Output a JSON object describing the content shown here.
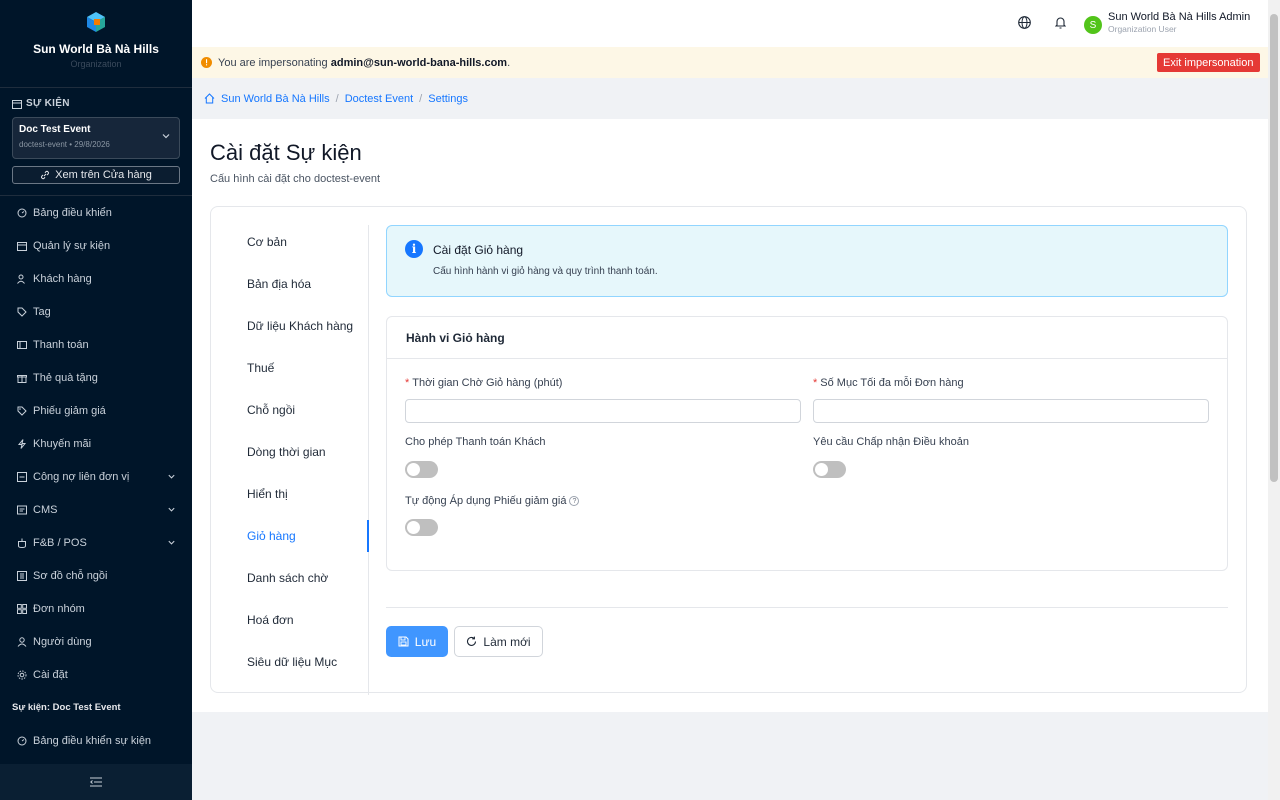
{
  "org": {
    "name": "Sun World Bà Nà Hills",
    "subtitle": "Organization"
  },
  "event_section": {
    "heading": "SỰ KIỆN",
    "event_name": "Doc Test Event",
    "event_meta": "doctest-event • 29/8/2026",
    "view_store": "Xem trên Cửa hàng"
  },
  "nav": {
    "items": [
      {
        "label": "Bảng điều khiển",
        "icon": "dashboard-icon"
      },
      {
        "label": "Quản lý sự kiện",
        "icon": "calendar-icon"
      },
      {
        "label": "Khách hàng",
        "icon": "users-icon"
      },
      {
        "label": "Tag",
        "icon": "tag-icon"
      },
      {
        "label": "Thanh toán",
        "icon": "payment-icon"
      },
      {
        "label": "Thẻ quà tặng",
        "icon": "gift-icon"
      },
      {
        "label": "Phiếu giảm giá",
        "icon": "coupon-icon"
      },
      {
        "label": "Khuyến mãi",
        "icon": "promo-icon"
      },
      {
        "label": "Công nợ liên đơn vị",
        "icon": "debt-icon"
      },
      {
        "label": "CMS",
        "icon": "cms-icon"
      },
      {
        "label": "F&B / POS",
        "icon": "fnb-icon"
      },
      {
        "label": "Sơ đồ chỗ ngồi",
        "icon": "seatmap-icon"
      },
      {
        "label": "Đơn nhóm",
        "icon": "group-order-icon"
      },
      {
        "label": "Người dùng",
        "icon": "user-icon"
      },
      {
        "label": "Cài đặt",
        "icon": "gear-icon"
      }
    ],
    "group_title": "Sự kiện: Doc Test Event",
    "event_dashboard": "Bảng điều khiển sự kiện"
  },
  "topbar": {
    "user_name": "Sun World Bà Nà Hills Admin",
    "user_role": "Organization User",
    "avatar_letter": "S"
  },
  "impersonation": {
    "prefix": "You are impersonating ",
    "email": "admin@sun-world-bana-hills.com",
    "suffix": ".",
    "exit_label": "Exit impersonation"
  },
  "breadcrumb": {
    "home": "Sun World Bà Nà Hills",
    "event": "Doctest Event",
    "current": "Settings"
  },
  "page": {
    "title": "Cài đặt Sự kiện",
    "subtitle": "Cấu hình cài đặt cho doctest-event"
  },
  "tabs": [
    "Cơ bản",
    "Bản địa hóa",
    "Dữ liệu Khách hàng",
    "Thuế",
    "Chỗ ngồi",
    "Dòng thời gian",
    "Hiển thị",
    "Giỏ hàng",
    "Danh sách chờ",
    "Hoá đơn",
    "Siêu dữ liệu Mục"
  ],
  "active_tab": "Giỏ hàng",
  "info": {
    "title": "Cài đặt Giỏ hàng",
    "desc": "Cấu hình hành vi giỏ hàng và quy trình thanh toán."
  },
  "cart_card": {
    "header": "Hành vi Giỏ hàng",
    "timeout_label": "Thời gian Chờ Giỏ hàng (phút)",
    "timeout_value": "",
    "max_items_label": "Số Mục Tối đa mỗi Đơn hàng",
    "max_items_value": "",
    "guest_checkout_label": "Cho phép Thanh toán Khách",
    "guest_checkout_on": false,
    "require_terms_label": "Yêu cầu Chấp nhận Điều khoản",
    "require_terms_on": false,
    "auto_coupon_label": "Tự động Áp dụng Phiếu giảm giá",
    "auto_coupon_on": false
  },
  "actions": {
    "save": "Lưu",
    "reset": "Làm mới"
  }
}
